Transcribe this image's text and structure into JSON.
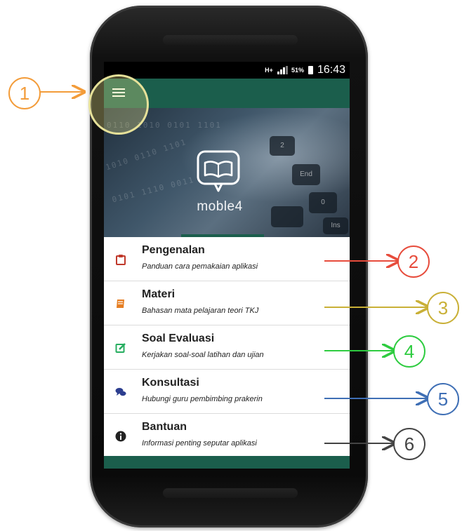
{
  "status_bar": {
    "network": "H+",
    "battery": "51%",
    "time": "16:43"
  },
  "hero": {
    "app_name": "moble4",
    "keys": [
      "2",
      "End",
      "0",
      "Ins"
    ]
  },
  "menu": {
    "items": [
      {
        "title": "Pengenalan",
        "description": "Panduan cara pemakaian aplikasi",
        "icon": "clipboard-icon",
        "color": "#c0392b"
      },
      {
        "title": "Materi",
        "description": "Bahasan mata pelajaran teori TKJ",
        "icon": "book-icon",
        "color": "#e67e22"
      },
      {
        "title": "Soal Evaluasi",
        "description": "Kerjakan soal-soal latihan dan ujian",
        "icon": "edit-icon",
        "color": "#27ae60"
      },
      {
        "title": "Konsultasi",
        "description": "Hubungi guru pembimbing prakerin",
        "icon": "chat-icon",
        "color": "#2c3e8f"
      },
      {
        "title": "Bantuan",
        "description": "Informasi penting seputar aplikasi",
        "icon": "info-icon",
        "color": "#222222"
      }
    ]
  },
  "annotations": [
    {
      "number": "1",
      "color": "#f39c3a"
    },
    {
      "number": "2",
      "color": "#e74c3c"
    },
    {
      "number": "3",
      "color": "#c9b037"
    },
    {
      "number": "4",
      "color": "#2ecc40"
    },
    {
      "number": "5",
      "color": "#3f6fb5"
    },
    {
      "number": "6",
      "color": "#444444"
    }
  ],
  "colors": {
    "appbar": "#1b5e4c",
    "highlight": "#f6f08c"
  }
}
